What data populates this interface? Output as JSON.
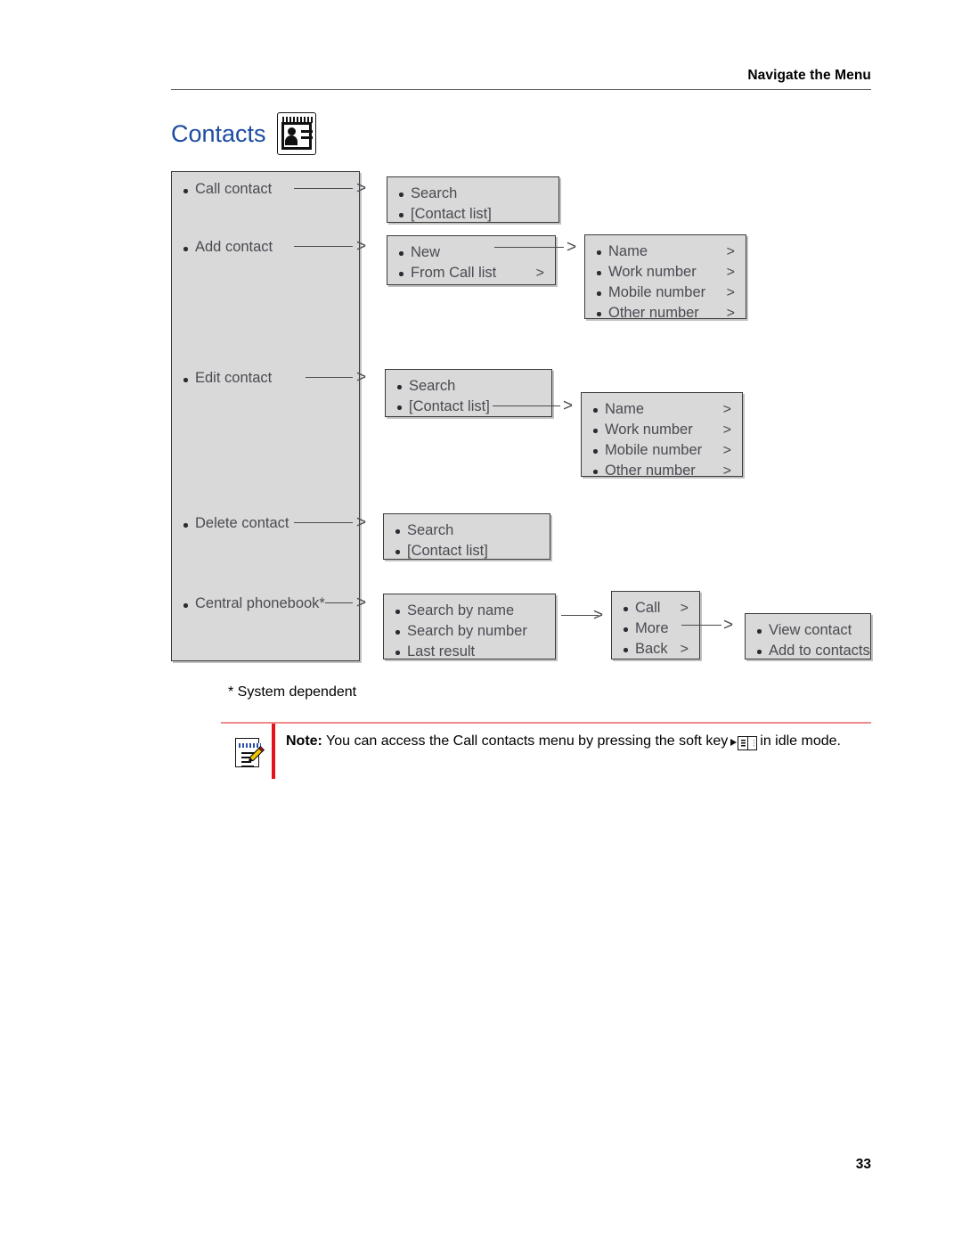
{
  "header": {
    "section_title": "Navigate the Menu"
  },
  "page": {
    "title": "Contacts",
    "title_icon": "contact-card-icon",
    "number": "33",
    "footnote": "* System dependent"
  },
  "diagram": {
    "type": "menu-tree",
    "root": {
      "name": "contacts-menu",
      "items": [
        {
          "label": "Call contact"
        },
        {
          "label": "Add contact"
        },
        {
          "label": "Edit contact"
        },
        {
          "label": "Delete contact"
        },
        {
          "label": "Central phonebook*"
        }
      ]
    },
    "level2": {
      "call_contact": {
        "items": [
          {
            "label": "Search",
            "chevron": ""
          },
          {
            "label": "[Contact list]",
            "chevron": ""
          }
        ]
      },
      "add_contact": {
        "items": [
          {
            "label": "New",
            "chevron": ""
          },
          {
            "label": "From Call list",
            "chevron": ">"
          }
        ]
      },
      "edit_contact": {
        "items": [
          {
            "label": "Search",
            "chevron": ""
          },
          {
            "label": "[Contact list]",
            "chevron": ""
          }
        ]
      },
      "delete_contact": {
        "items": [
          {
            "label": "Search",
            "chevron": ""
          },
          {
            "label": "[Contact list]",
            "chevron": ""
          }
        ]
      },
      "central_phonebook": {
        "items": [
          {
            "label": "Search by name",
            "chevron": ""
          },
          {
            "label": "Search by number",
            "chevron": ""
          },
          {
            "label": "Last result",
            "chevron": ""
          }
        ]
      }
    },
    "level3": {
      "add_contact_fields": {
        "items": [
          {
            "label": "Name",
            "chevron": ">"
          },
          {
            "label": "Work number",
            "chevron": ">"
          },
          {
            "label": "Mobile number",
            "chevron": ">"
          },
          {
            "label": "Other number",
            "chevron": ">"
          }
        ]
      },
      "edit_contact_fields": {
        "items": [
          {
            "label": "Name",
            "chevron": ">"
          },
          {
            "label": "Work number",
            "chevron": ">"
          },
          {
            "label": "Mobile number",
            "chevron": ">"
          },
          {
            "label": "Other number",
            "chevron": ">"
          }
        ]
      },
      "phonebook_result": {
        "items": [
          {
            "label": "Call",
            "chevron": ">"
          },
          {
            "label": "More",
            "chevron": ""
          },
          {
            "label": "Back",
            "chevron": ">"
          }
        ]
      }
    },
    "level4": {
      "phonebook_more": {
        "items": [
          {
            "label": "View contact",
            "chevron": ""
          },
          {
            "label": "Add to contacts",
            "chevron": ""
          }
        ]
      }
    },
    "colors": {
      "box_fill": "#d9d9d9",
      "box_border": "#3b3b3b",
      "text": "#4a4a52"
    }
  },
  "note": {
    "icon": "note-pencil-icon",
    "label": "Note:",
    "text_before": "You can access the Call contacts menu by pressing the soft key",
    "glyph": "softkey-phonebook-icon",
    "text_after": "in idle mode.",
    "accent_color": "#e8131a"
  }
}
